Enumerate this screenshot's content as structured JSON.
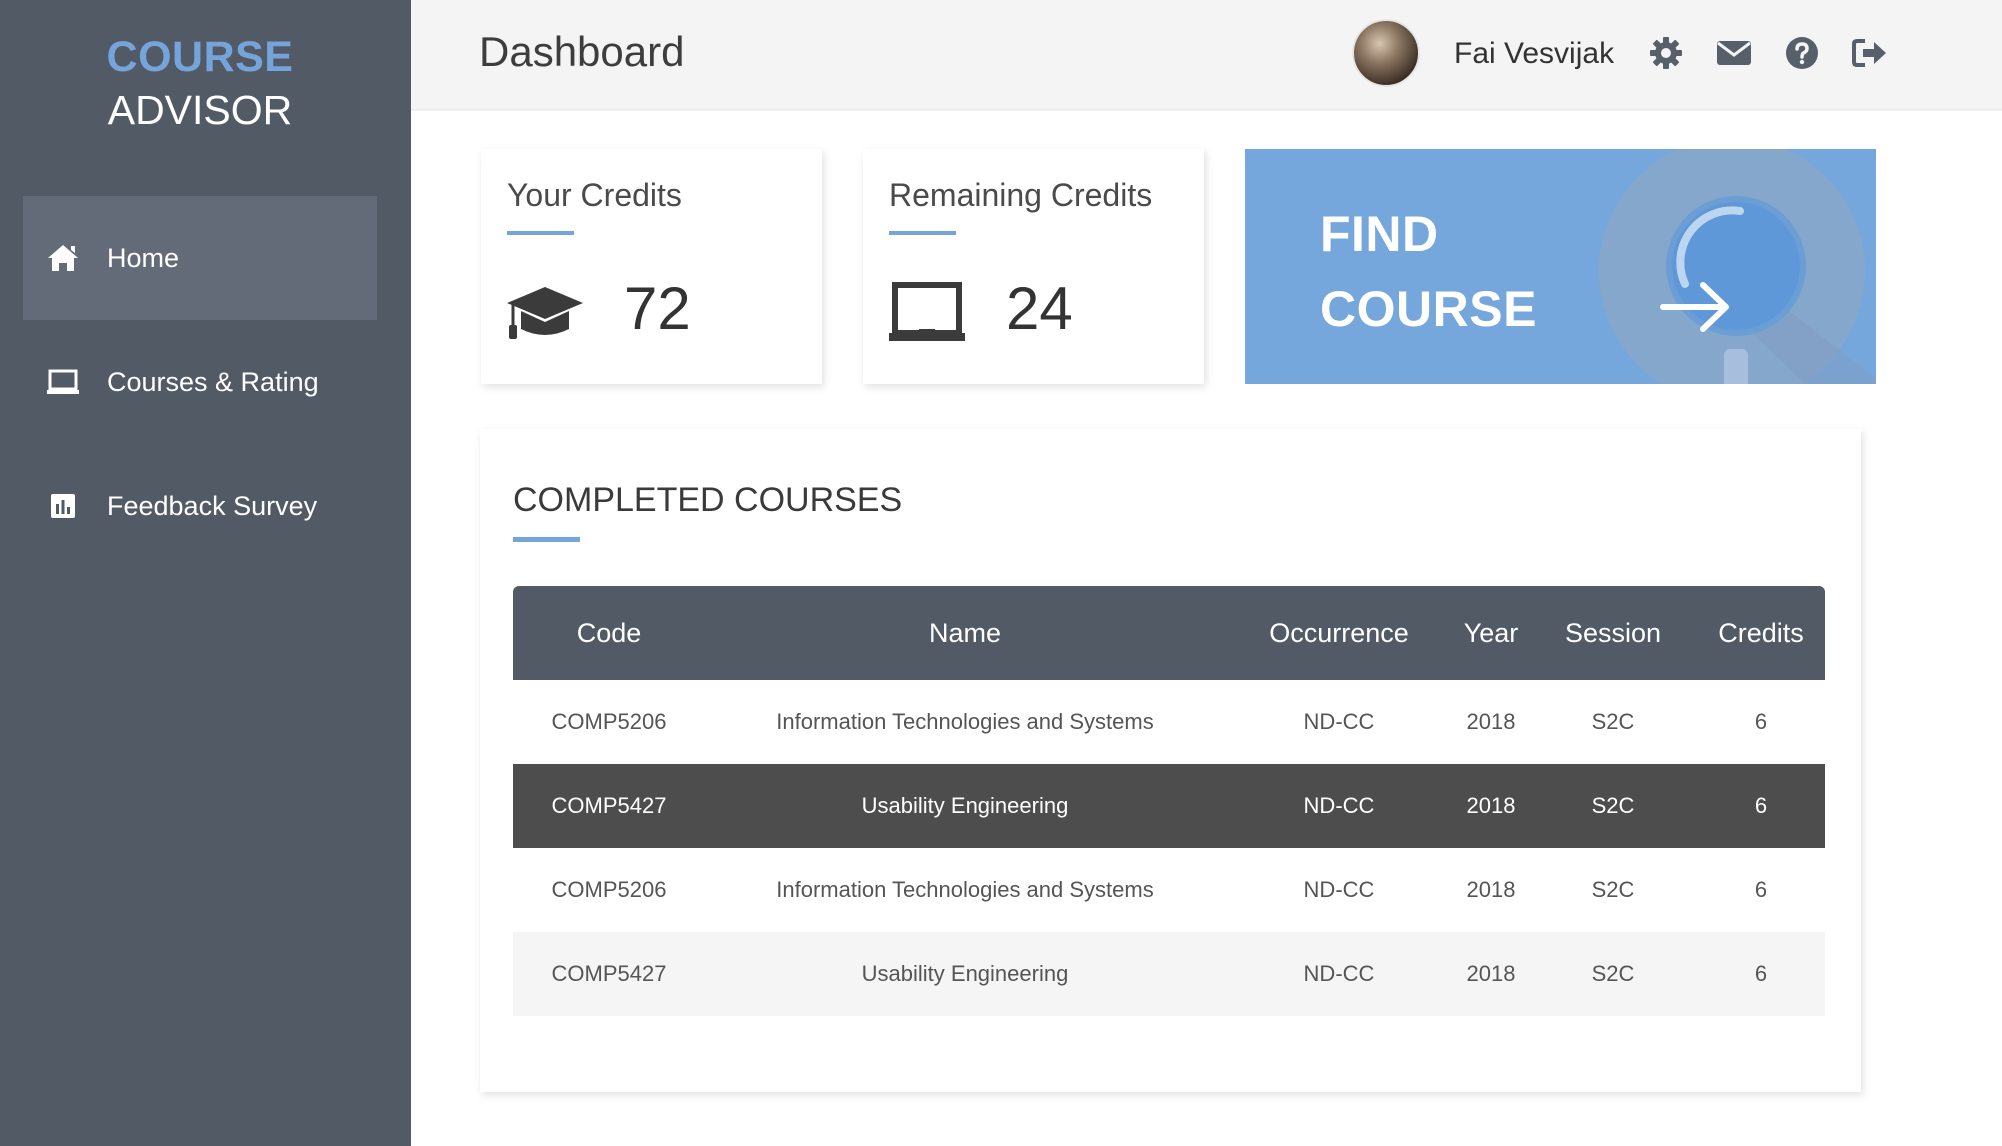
{
  "logo": {
    "line1": "COURSE",
    "line2": "ADVISOR"
  },
  "sidebar": {
    "items": [
      {
        "label": "Home",
        "icon": "home-icon",
        "active": true
      },
      {
        "label": "Courses & Rating",
        "icon": "laptop-icon",
        "active": false
      },
      {
        "label": "Feedback Survey",
        "icon": "bar-chart-icon",
        "active": false
      }
    ]
  },
  "header": {
    "title": "Dashboard",
    "user_name": "Fai Vesvijak",
    "icons": [
      "gear-icon",
      "envelope-icon",
      "help-icon",
      "sign-out-icon"
    ]
  },
  "cards": {
    "your_credits": {
      "title": "Your Credits",
      "value": "72",
      "icon": "graduation-cap-icon"
    },
    "remaining_credits": {
      "title": "Remaining Credits",
      "value": "24",
      "icon": "laptop-icon"
    },
    "find_course": {
      "line1": "FIND",
      "line2": "COURSE",
      "icon": "search-icon"
    }
  },
  "completed": {
    "title": "COMPLETED COURSES",
    "columns": [
      "Code",
      "Name",
      "Occurrence",
      "Year",
      "Session",
      "Credits"
    ],
    "rows": [
      {
        "code": "COMP5206",
        "name": "Information Technologies and Systems",
        "occurrence": "ND-CC",
        "year": "2018",
        "session": "S2C",
        "credits": "6"
      },
      {
        "code": "COMP5427",
        "name": "Usability Engineering",
        "occurrence": "ND-CC",
        "year": "2018",
        "session": "S2C",
        "credits": "6"
      },
      {
        "code": "COMP5206",
        "name": "Information Technologies and Systems",
        "occurrence": "ND-CC",
        "year": "2018",
        "session": "S2C",
        "credits": "6"
      },
      {
        "code": "COMP5427",
        "name": "Usability Engineering",
        "occurrence": "ND-CC",
        "year": "2018",
        "session": "S2C",
        "credits": "6"
      }
    ]
  },
  "colors": {
    "sidebar_bg": "#525a66",
    "accent": "#75a4da",
    "selected_row": "#4d4d4d"
  }
}
